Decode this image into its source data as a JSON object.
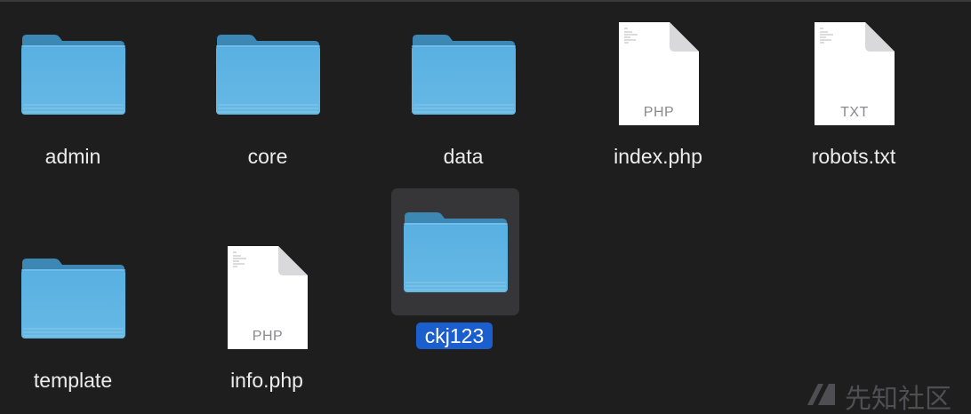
{
  "files": [
    {
      "name": "admin",
      "kind": "folder",
      "icon": "folder-icon"
    },
    {
      "name": "core",
      "kind": "folder",
      "icon": "folder-icon"
    },
    {
      "name": "data",
      "kind": "folder",
      "icon": "folder-icon"
    },
    {
      "name": "index.php",
      "kind": "document",
      "icon": "php-file-icon",
      "badge": "PHP"
    },
    {
      "name": "robots.txt",
      "kind": "document",
      "icon": "txt-file-icon",
      "badge": "TXT"
    },
    {
      "name": "template",
      "kind": "folder",
      "icon": "folder-icon"
    },
    {
      "name": "info.php",
      "kind": "document",
      "icon": "php-file-icon",
      "badge": "PHP"
    },
    {
      "name": "ckj123",
      "kind": "folder",
      "icon": "folder-icon",
      "selected": true
    }
  ],
  "watermark": {
    "text": "先知社区"
  },
  "colors": {
    "background": "#1e1e1f",
    "folder": "#5fb2e2",
    "selection_label": "#1b5fcf",
    "selection_tile": "#363638"
  }
}
